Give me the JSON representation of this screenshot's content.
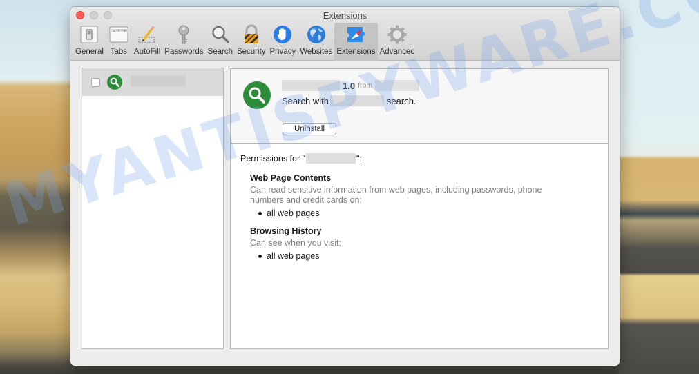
{
  "window": {
    "title": "Extensions",
    "traffic_lights": [
      "close",
      "minimize",
      "zoom"
    ]
  },
  "toolbar": {
    "items": [
      {
        "label": "General",
        "icon": "general-switch-icon"
      },
      {
        "label": "Tabs",
        "icon": "tabs-icon"
      },
      {
        "label": "AutoFill",
        "icon": "pencil-icon"
      },
      {
        "label": "Passwords",
        "icon": "key-icon"
      },
      {
        "label": "Search",
        "icon": "magnifier-icon"
      },
      {
        "label": "Security",
        "icon": "padlock-icon"
      },
      {
        "label": "Privacy",
        "icon": "hand-icon"
      },
      {
        "label": "Websites",
        "icon": "globe-icon"
      },
      {
        "label": "Extensions",
        "icon": "puzzle-compass-icon"
      },
      {
        "label": "Advanced",
        "icon": "gear-icon"
      }
    ],
    "active": "Extensions"
  },
  "extension_list": {
    "items": [
      {
        "name": "[redacted]",
        "enabled": false,
        "icon": "green-search-icon",
        "selected": true
      }
    ]
  },
  "details": {
    "version": "1.0",
    "from_label": "from",
    "description_prefix": "Search with",
    "description_suffix": "search.",
    "uninstall_label": "Uninstall",
    "permissions_prefix": "Permissions for \"",
    "permissions_suffix": "\":",
    "permissions": [
      {
        "title": "Web Page Contents",
        "description": "Can read sensitive information from web pages, including passwords, phone numbers and credit cards on:",
        "scope": [
          "all web pages"
        ]
      },
      {
        "title": "Browsing History",
        "description": "Can see when you visit:",
        "scope": [
          "all web pages"
        ]
      }
    ]
  },
  "watermark": "MYANTISPYWARE.COM",
  "colors": {
    "close_red": "#fd5f57",
    "extension_green": "#2d8c3a",
    "active_tab_bg": "#c4c4c4"
  }
}
